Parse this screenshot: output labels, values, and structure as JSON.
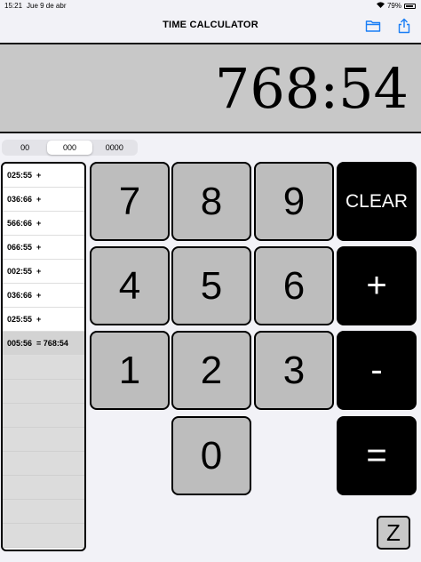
{
  "status_bar": {
    "time": "15:21",
    "date": "Jue 9 de abr",
    "battery": "79%"
  },
  "header": {
    "title": "TIME CALCULATOR",
    "left_icon": "folder-icon",
    "right_icon": "share-icon",
    "accent": "#1a7ef5"
  },
  "display": {
    "value": "768:54"
  },
  "format_segments": [
    {
      "label": "00",
      "selected": false
    },
    {
      "label": "000",
      "selected": true
    },
    {
      "label": "0000",
      "selected": false
    }
  ],
  "history": [
    {
      "time": "025:55",
      "op": "+"
    },
    {
      "time": "036:66",
      "op": "+"
    },
    {
      "time": "566:66",
      "op": "+"
    },
    {
      "time": "066:55",
      "op": "+"
    },
    {
      "time": "002:55",
      "op": "+"
    },
    {
      "time": "036:66",
      "op": "+"
    },
    {
      "time": "025:55",
      "op": "+"
    },
    {
      "time": "005:56",
      "op": "= 768:54",
      "selected": true
    }
  ],
  "keypad": {
    "k7": "7",
    "k8": "8",
    "k9": "9",
    "clear": "CLEAR",
    "k4": "4",
    "k5": "5",
    "k6": "6",
    "plus": "+",
    "k1": "1",
    "k2": "2",
    "k3": "3",
    "minus": "-",
    "k0": "0",
    "equals": "="
  },
  "z_button": "Z"
}
